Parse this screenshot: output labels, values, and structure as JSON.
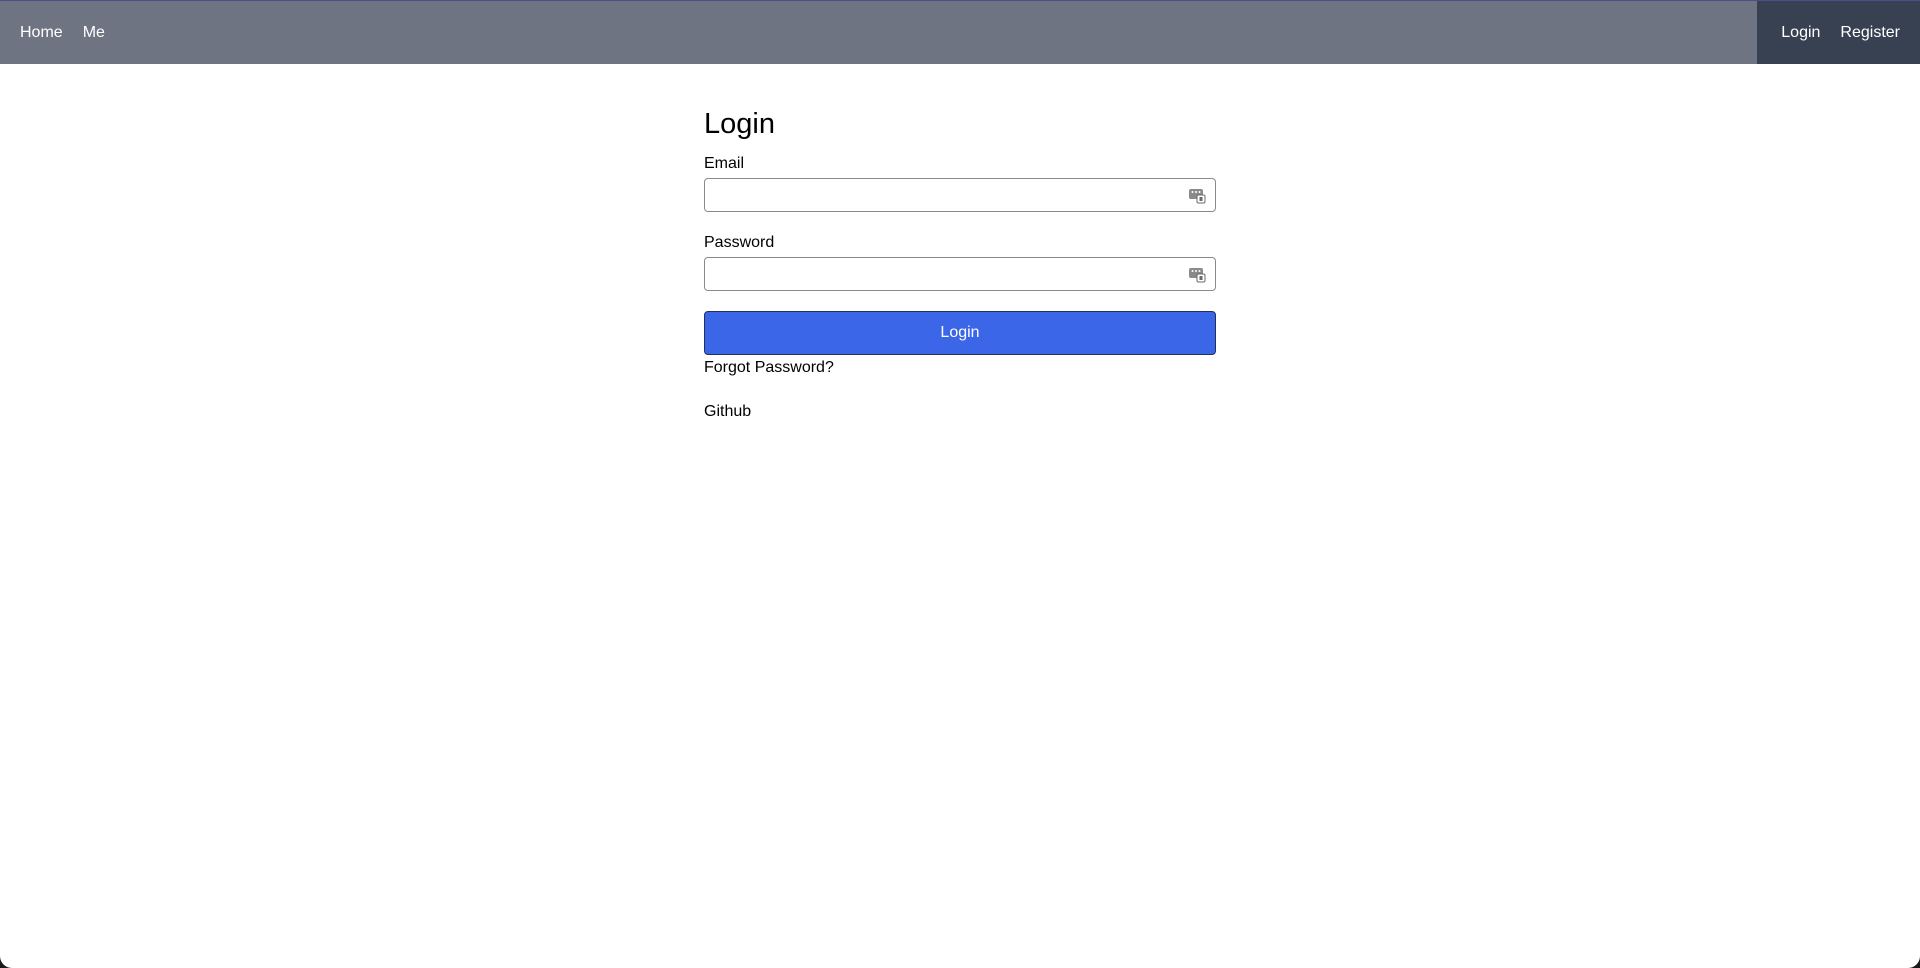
{
  "navbar": {
    "left_links": [
      "Home",
      "Me"
    ],
    "right_links": [
      "Login",
      "Register"
    ],
    "colors": {
      "bar": "#6e7481",
      "right_panel": "#384152"
    }
  },
  "login_form": {
    "title": "Login",
    "email_label": "Email",
    "email_value": "",
    "password_label": "Password",
    "password_value": "",
    "submit_label": "Login",
    "forgot_password": "Forgot Password?",
    "github": "Github",
    "autofill_icon": "password-autofill-icon",
    "colors": {
      "button": "#3a66e7"
    }
  }
}
